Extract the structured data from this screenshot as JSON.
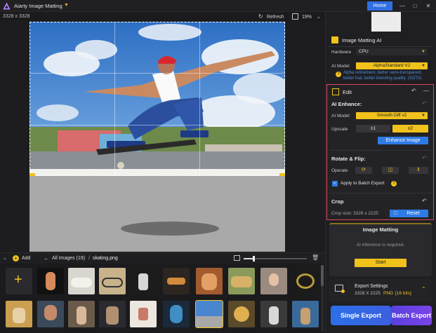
{
  "app": {
    "title": "Aiarty Image Matting",
    "home_label": "Home"
  },
  "canvas": {
    "dimensions": "3328 x 3328",
    "refresh_label": "Refresh",
    "zoom_level": "19%"
  },
  "gallery": {
    "add_label": "Add",
    "all_images_label": "All Images (19)",
    "separator": "/",
    "current_file": "skating.png"
  },
  "panel": {
    "model_header": "Image Matting AI",
    "hardware_label": "Hardware",
    "hardware_value": "CPU",
    "ai_model_label": "AI Model",
    "ai_model_value": "AlphaStandard  V2",
    "ai_model_hint": "Alpha refinement, better semi-transparent, better hair, better blending quality. (SOTA)",
    "edit": {
      "title": "Edit",
      "enhance_title": "AI Enhance:",
      "enhance_model_label": "AI Model",
      "enhance_model_value": "Smooth Diff v2",
      "upscale_label": "Upscale",
      "upscale_x1": "x1",
      "upscale_x2": "x2",
      "enhance_button": "Enhance Image",
      "rotate_title": "Rotate & Flip:",
      "operate_label": "Operate",
      "apply_batch_label": "Apply to Batch Export",
      "crop_title": "Crop",
      "crop_size": "Crop size: 3328 x 2225",
      "reset_label": "Reset"
    },
    "matting": {
      "title": "Image Matting",
      "status": "AI inference is required.",
      "start_label": "Start"
    },
    "export": {
      "title": "Export Settings",
      "size": "3328 X 2225",
      "format": "PNG",
      "bits": "[16 bits]",
      "single_label": "Single Export",
      "batch_label": "Batch Export"
    }
  },
  "colors": {
    "accent_yellow": "#f1c21b",
    "accent_blue": "#2f7be6",
    "edit_border": "#e0455d"
  }
}
